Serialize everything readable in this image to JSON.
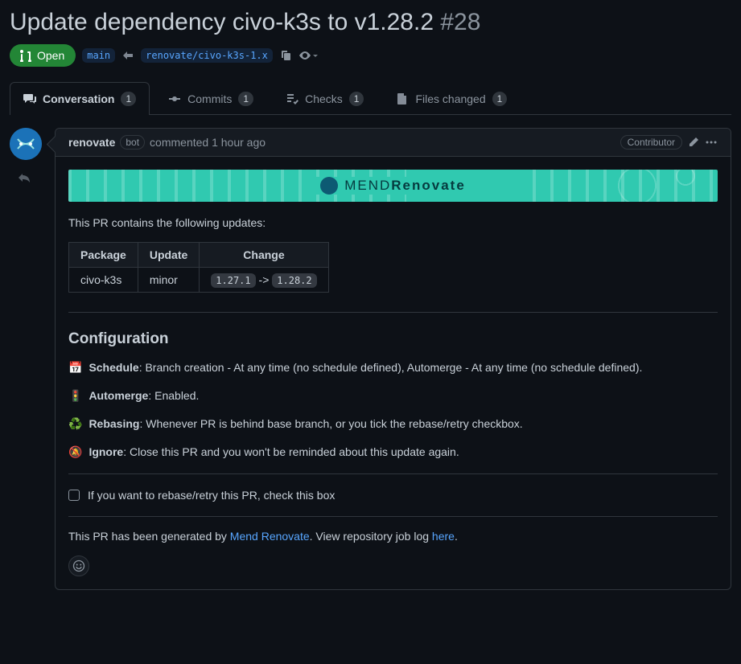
{
  "title": "Update dependency civo-k3s to v1.28.2",
  "issue_number": "#28",
  "state": "Open",
  "base_branch": "main",
  "head_branch": "renovate/civo-k3s-1.x",
  "tabs": {
    "conversation": {
      "label": "Conversation",
      "count": "1"
    },
    "commits": {
      "label": "Commits",
      "count": "1"
    },
    "checks": {
      "label": "Checks",
      "count": "1"
    },
    "files": {
      "label": "Files changed",
      "count": "1"
    }
  },
  "comment": {
    "author": "renovate",
    "author_badge": "bot",
    "time_prefix": "commented ",
    "time": "1 hour ago",
    "association": "Contributor"
  },
  "banner": {
    "brand_a": "MEND",
    "brand_b": "Renovate"
  },
  "intro": "This PR contains the following updates:",
  "table": {
    "headers": {
      "package": "Package",
      "update": "Update",
      "change": "Change"
    },
    "row": {
      "package": "civo-k3s",
      "update": "minor",
      "from": "1.27.1",
      "arrow": " -> ",
      "to": "1.28.2"
    }
  },
  "config_heading": "Configuration",
  "config": {
    "schedule_emoji": "📅",
    "schedule_label": "Schedule",
    "schedule_text": ": Branch creation - At any time (no schedule defined), Automerge - At any time (no schedule defined).",
    "automerge_emoji": "🚦",
    "automerge_label": "Automerge",
    "automerge_text": ": Enabled.",
    "rebasing_emoji": "♻️",
    "rebasing_label": "Rebasing",
    "rebasing_text": ": Whenever PR is behind base branch, or you tick the rebase/retry checkbox.",
    "ignore_emoji": "🔕",
    "ignore_label": "Ignore",
    "ignore_text": ": Close this PR and you won't be reminded about this update again."
  },
  "task": {
    "text": "If you want to rebase/retry this PR, check this box"
  },
  "footer": {
    "prefix": "This PR has been generated by ",
    "link1": "Mend Renovate",
    "mid": ". View repository job log ",
    "link2": "here",
    "suffix": "."
  }
}
